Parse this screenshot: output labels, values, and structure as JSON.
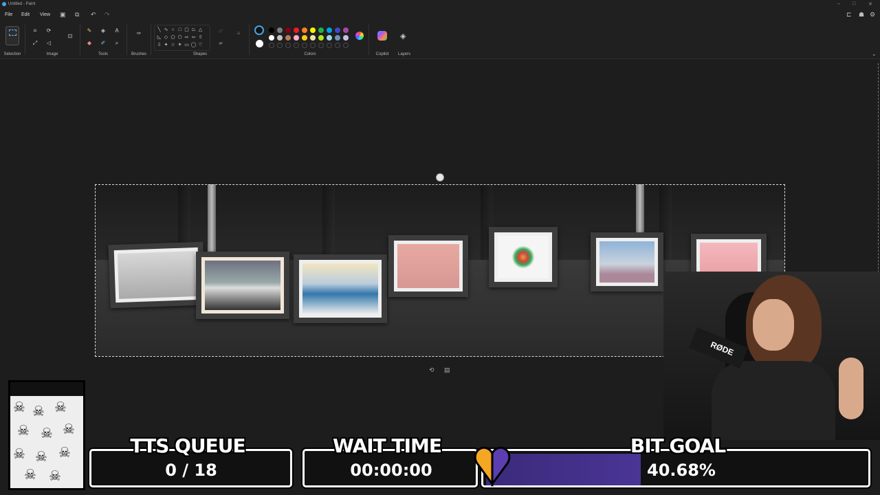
{
  "window": {
    "title": "Untitled - Paint"
  },
  "menu": {
    "file": "File",
    "edit": "Edit",
    "view": "View"
  },
  "ribbon": {
    "groups": [
      "Selection",
      "Image",
      "Tools",
      "Brushes",
      "Shapes",
      "Colors",
      "Copilot",
      "Layers"
    ]
  },
  "colors": {
    "palette_row1": [
      "#000000",
      "#7f7f7f",
      "#880015",
      "#ed1c24",
      "#ff7f27",
      "#fff200",
      "#22b14c",
      "#00a2e8",
      "#3f48cc",
      "#a349a4"
    ],
    "palette_row2": [
      "#ffffff",
      "#c3c3c3",
      "#b97a57",
      "#ffaec9",
      "#ffc90e",
      "#efe4b0",
      "#b5e61d",
      "#99d9ea",
      "#7092be",
      "#c8bfe7"
    ],
    "primary": "#000000",
    "secondary": "#ffffff"
  },
  "icons": [
    "undo-icon",
    "redo-icon",
    "save-icon",
    "share-icon",
    "settings-icon",
    "layers-icon",
    "copilot-icon",
    "color-wheel-icon"
  ],
  "overlay": {
    "tts": {
      "title": "TTS QUEUE",
      "value": "0 / 18"
    },
    "wait": {
      "title": "WAIT TIME",
      "value": "00:00:00"
    },
    "bit": {
      "title": "BIT GOAL",
      "value": "40.68%",
      "progress": 0.4068
    }
  },
  "webcam": {
    "mic_brand": "RØDE"
  }
}
